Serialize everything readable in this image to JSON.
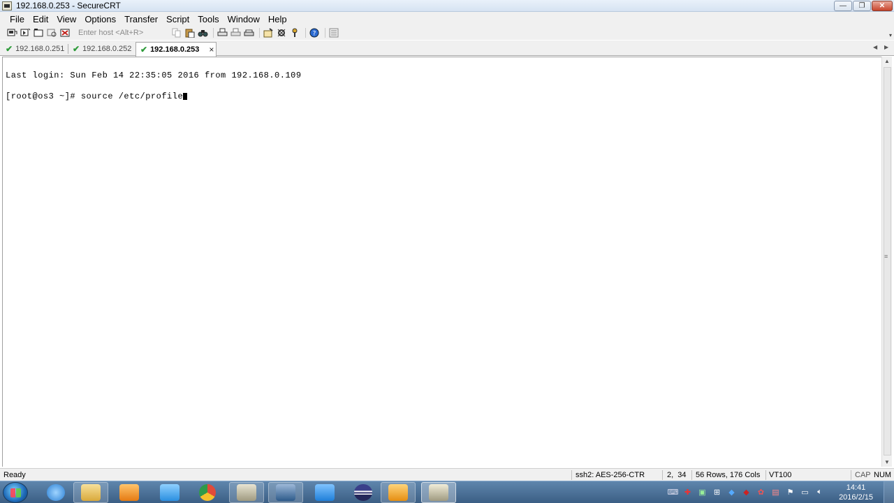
{
  "window": {
    "title": "192.168.0.253 - SecureCRT",
    "minimize_glyph": "—",
    "restore_glyph": "❐",
    "close_glyph": "✕"
  },
  "menu": [
    "File",
    "Edit",
    "View",
    "Options",
    "Transfer",
    "Script",
    "Tools",
    "Window",
    "Help"
  ],
  "toolbar": {
    "quick_connect_placeholder": "Enter host <Alt+R>",
    "icons": [
      "connect-icon",
      "quick-connect-icon",
      "connect-tab-icon",
      "reconnect-icon",
      "disconnect-icon",
      "copy-icon",
      "paste-icon",
      "find-icon",
      "print-icon",
      "print-selection-icon",
      "print-setup-icon",
      "session-options-icon",
      "global-options-icon",
      "keymap-icon",
      "help-icon",
      "sftp-icon"
    ]
  },
  "tabs": [
    {
      "label": "192.168.0.251",
      "active": false
    },
    {
      "label": "192.168.0.252",
      "active": false
    },
    {
      "label": "192.168.0.253",
      "active": true
    }
  ],
  "tab_close_glyph": "×",
  "terminal": {
    "lines": [
      "Last login: Sun Feb 14 22:35:05 2016 from 192.168.0.109",
      "[root@os3 ~]# source /etc/profile"
    ]
  },
  "status": {
    "state": "Ready",
    "protocol": "ssh2: AES-256-CTR",
    "cursor_pos": "2,  34",
    "size": "56 Rows, 176 Cols",
    "emulation": "VT100",
    "caps": "CAP",
    "num": "NUM"
  },
  "taskbar": {
    "apps": [
      {
        "name": "ie-icon",
        "color": "#2a7fd4",
        "state": "pinned"
      },
      {
        "name": "explorer-icon",
        "color": "#e9c15a",
        "state": "open"
      },
      {
        "name": "media-player-icon",
        "color": "#f08a1c",
        "state": "pinned"
      },
      {
        "name": "baidu-cloud-icon",
        "color": "#3aa0e8",
        "state": "pinned"
      },
      {
        "name": "chrome-icon",
        "color": "#e04b3a",
        "state": "pinned"
      },
      {
        "name": "securecrt-icon",
        "color": "#b8b49a",
        "state": "open"
      },
      {
        "name": "vpn-icon",
        "color": "#3a6ea5",
        "state": "open"
      },
      {
        "name": "feishu-icon",
        "color": "#2b8fe6",
        "state": "pinned"
      },
      {
        "name": "eclipse-icon",
        "color": "#2c2f6e",
        "state": "pinned"
      },
      {
        "name": "vmware-icon",
        "color": "#f3a21c",
        "state": "open"
      },
      {
        "name": "securefx-icon",
        "color": "#b8b49a",
        "state": "active"
      }
    ],
    "clock_time": "14:41",
    "clock_date": "2016/2/15"
  }
}
